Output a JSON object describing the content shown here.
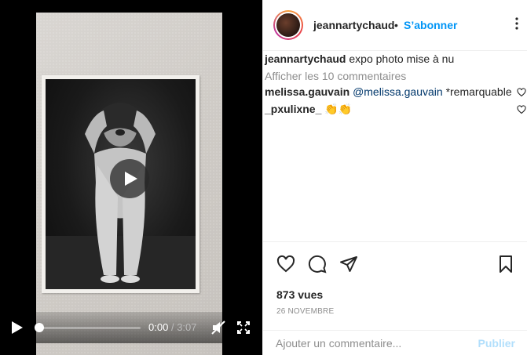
{
  "post": {
    "username": "jeannartychaud",
    "separator": "•",
    "follow_label": "S’abonner",
    "caption_user": "jeannartychaud",
    "caption_text": "expo photo mise à nu",
    "view_all_comments": "Afficher les 10 commentaires",
    "views": "873 vues",
    "date": "26 NOVEMBRE"
  },
  "comments": [
    {
      "user": "melissa.gauvain",
      "mention": "@melissa.gauvain",
      "text": "*remarquable"
    },
    {
      "user": "_pxulixne_",
      "mention": "",
      "text": "👏👏"
    }
  ],
  "player": {
    "current_time": "0:00",
    "separator": "/",
    "duration": "3:07",
    "progress_fraction": 0.0
  },
  "add_comment": {
    "placeholder": "Ajouter un commentaire...",
    "publish_label": "Publier"
  },
  "icons": {
    "play": "play-icon",
    "mute": "mute-icon",
    "fullscreen": "fullscreen-icon",
    "like": "heart-icon",
    "comment": "comment-icon",
    "share": "share-icon",
    "save": "bookmark-icon",
    "more": "more-options-icon"
  },
  "colors": {
    "accent": "#0095f6",
    "publish_disabled": "#b2dffc",
    "muted_text": "#8e8e8e"
  }
}
